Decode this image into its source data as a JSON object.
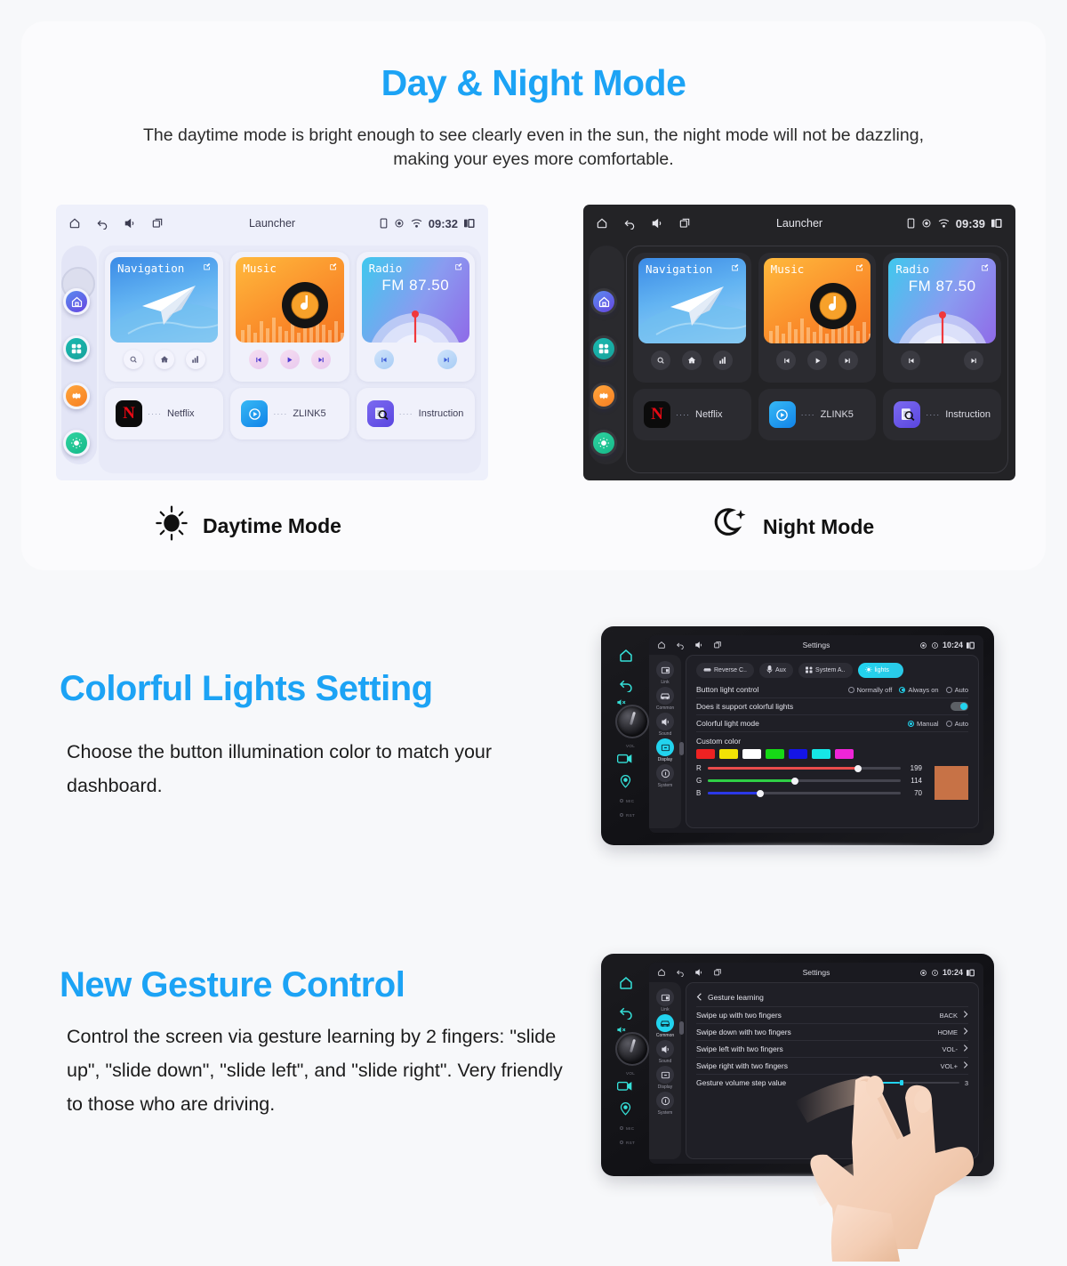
{
  "hero": {
    "title": "Day & Night Mode",
    "subtitle": "The daytime mode is bright enough to see clearly even in the sun, the night mode will not be dazzling, making your eyes more comfortable.",
    "accent_color": "#1ca3f5"
  },
  "launcher_day": {
    "status": {
      "title": "Launcher",
      "time": "09:32"
    },
    "widgets": [
      {
        "name": "Navigation",
        "controls": [
          "search-icon",
          "home-icon",
          "chart-icon"
        ]
      },
      {
        "name": "Music",
        "controls": [
          "prev-icon",
          "play-icon",
          "next-icon"
        ]
      },
      {
        "name": "Radio",
        "frequency": "FM 87.50",
        "controls": [
          "prev-icon",
          "next-icon"
        ]
      }
    ],
    "apps": [
      {
        "label": "Netflix",
        "icon": "netflix-icon"
      },
      {
        "label": "ZLINK5",
        "icon": "zlink-icon"
      },
      {
        "label": "Instruction",
        "icon": "instruction-icon"
      }
    ],
    "rail": [
      "home-icon",
      "apps-icon",
      "settings-icon",
      "brightness-icon"
    ]
  },
  "launcher_night": {
    "status": {
      "title": "Launcher",
      "time": "09:39"
    },
    "widgets": [
      {
        "name": "Navigation",
        "controls": [
          "search-icon",
          "home-icon",
          "chart-icon"
        ]
      },
      {
        "name": "Music",
        "controls": [
          "prev-icon",
          "play-icon",
          "next-icon"
        ]
      },
      {
        "name": "Radio",
        "frequency": "FM 87.50",
        "controls": [
          "prev-icon",
          "next-icon"
        ]
      }
    ],
    "apps": [
      {
        "label": "Netflix",
        "icon": "netflix-icon"
      },
      {
        "label": "ZLINK5",
        "icon": "zlink-icon"
      },
      {
        "label": "Instruction",
        "icon": "instruction-icon"
      }
    ],
    "rail": [
      "home-icon",
      "apps-icon",
      "settings-icon",
      "brightness-icon"
    ]
  },
  "mode_captions": {
    "day": "Daytime Mode",
    "night": "Night Mode"
  },
  "lights_section": {
    "title": "Colorful Lights Setting",
    "body": "Choose the button illumination color to match your dashboard."
  },
  "gesture_section": {
    "title": "New Gesture Control",
    "body": "Control the screen via gesture learning by 2 fingers: \"slide up\", \"slide down\", \"slide left\", and \"slide right\". Very friendly to those who are driving."
  },
  "device_lights": {
    "status": {
      "title": "Settings",
      "time": "10:24"
    },
    "bezel_labels": [
      "MIC",
      "RST",
      "VOL"
    ],
    "sidebar": [
      {
        "label": "Link",
        "icon": "link-icon",
        "active": false
      },
      {
        "label": "Common",
        "icon": "car-icon",
        "active": false
      },
      {
        "label": "Sound",
        "icon": "sound-icon",
        "active": false
      },
      {
        "label": "Display",
        "icon": "display-icon",
        "active": true
      },
      {
        "label": "System",
        "icon": "info-icon",
        "active": false
      }
    ],
    "chips": [
      {
        "label": "Reverse C..",
        "icon": "car-rear-icon",
        "active": false
      },
      {
        "label": "Aux",
        "icon": "mic-icon",
        "active": false
      },
      {
        "label": "System A..",
        "icon": "grid-icon",
        "active": false
      },
      {
        "label": "lights",
        "icon": "bulb-icon",
        "active": true
      }
    ],
    "rows": [
      {
        "label": "Button light control",
        "options": [
          {
            "label": "Normally off",
            "selected": false
          },
          {
            "label": "Always on",
            "selected": true
          },
          {
            "label": "Auto",
            "selected": false
          }
        ]
      },
      {
        "label": "Does it support colorful lights",
        "toggle": true
      },
      {
        "label": "Colorful light mode",
        "options": [
          {
            "label": "Manual",
            "selected": true
          },
          {
            "label": "Auto",
            "selected": false
          }
        ]
      }
    ],
    "custom_color_label": "Custom color",
    "swatches": [
      "#ee2222",
      "#f2e205",
      "#ffffff",
      "#16d916",
      "#1414e6",
      "#16e6e6",
      "#ef25d8"
    ],
    "rgb": [
      {
        "channel": "R",
        "value": 199,
        "color": "#e84c4c"
      },
      {
        "channel": "G",
        "value": 114,
        "color": "#2fcf46"
      },
      {
        "channel": "B",
        "value": 70,
        "color": "#2b38e8"
      }
    ],
    "preview_color": "#c77246"
  },
  "device_gesture": {
    "status": {
      "title": "Settings",
      "time": "10:24"
    },
    "bezel_labels": [
      "MIC",
      "RST",
      "VOL"
    ],
    "back_label": "Gesture learning",
    "sidebar": [
      {
        "label": "Link",
        "icon": "link-icon",
        "active": false
      },
      {
        "label": "Common",
        "icon": "car-icon",
        "active": true
      },
      {
        "label": "Sound",
        "icon": "sound-icon",
        "active": false
      },
      {
        "label": "Display",
        "icon": "display-icon",
        "active": false
      },
      {
        "label": "System",
        "icon": "info-icon",
        "active": false
      }
    ],
    "rows": [
      {
        "label": "Swipe up with two fingers",
        "value": "BACK"
      },
      {
        "label": "Swipe down with two fingers",
        "value": "HOME"
      },
      {
        "label": "Swipe left with two fingers",
        "value": "VOL-"
      },
      {
        "label": "Swipe right with two fingers",
        "value": "VOL+"
      }
    ],
    "step_row": {
      "label": "Gesture volume step value",
      "value": "3"
    }
  }
}
